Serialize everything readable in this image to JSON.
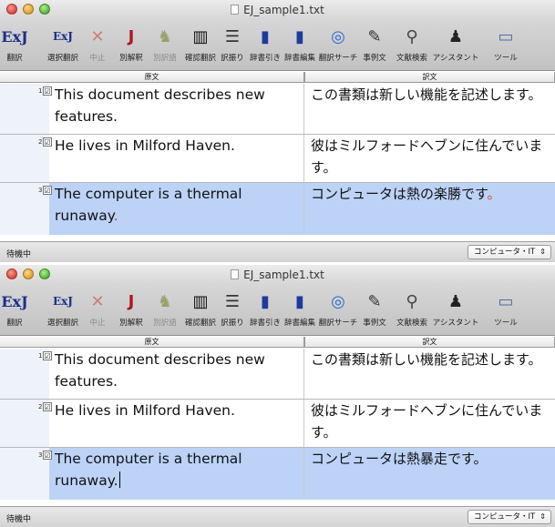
{
  "windows": [
    {
      "title": "EJ_sample1.txt",
      "toolbar": [
        {
          "label": "翻訳",
          "icon": "ExJ",
          "color": "#1a2f8a",
          "disabled": false
        },
        {
          "label": "選択翻訳",
          "icon": "ExJ",
          "color": "#1a2f8a",
          "disabled": false
        },
        {
          "label": "中止",
          "icon": "✕",
          "color": "#d23a2a",
          "disabled": true
        },
        {
          "label": "別解釈",
          "icon": "J",
          "color": "#b0171f",
          "disabled": false
        },
        {
          "label": "別訳語",
          "icon": "♞",
          "color": "#6e7d1a",
          "disabled": true
        },
        {
          "label": "確認翻訳",
          "icon": "▥",
          "color": "#111111",
          "disabled": false
        },
        {
          "label": "訳振り",
          "icon": "☰",
          "color": "#333333",
          "disabled": false
        },
        {
          "label": "辞書引き",
          "icon": "▮",
          "color": "#1d3b9e",
          "disabled": false
        },
        {
          "label": "辞書編集",
          "icon": "▮",
          "color": "#1d3b9e",
          "disabled": false
        },
        {
          "label": "翻訳サーチ",
          "icon": "◎",
          "color": "#2a6bd0",
          "disabled": false
        },
        {
          "label": "事例文",
          "icon": "✎",
          "color": "#333333",
          "disabled": false
        },
        {
          "label": "文献検索",
          "icon": "⚲",
          "color": "#444444",
          "disabled": false
        },
        {
          "label": "アシスタント",
          "icon": "♟",
          "color": "#222222",
          "disabled": false
        },
        {
          "label": "ツール",
          "icon": "▭",
          "color": "#4a6fa0",
          "disabled": false
        }
      ],
      "columns": {
        "source": "原文",
        "target": "訳文"
      },
      "rows": [
        {
          "num": "1",
          "checked": "☑",
          "source": "This document describes new features.",
          "target": "この書類は新しい機能を記述します。",
          "selected": false
        },
        {
          "num": "2",
          "checked": "☑",
          "source": "He lives in Milford Haven.",
          "target": "彼はミルフォードヘブンに住んでいます。",
          "selected": false
        },
        {
          "num": "3",
          "checked": "☑",
          "source_main": "The computer is a thermal runaway",
          "source_end": ".",
          "target_main": "コンピュータは熱の楽勝です",
          "target_end": "。",
          "selected": true
        }
      ],
      "status": "待機中",
      "field": "コンピュータ・IT",
      "field_arrow": "⇕"
    },
    {
      "title": "EJ_sample1.txt",
      "columns": {
        "source": "原文",
        "target": "訳文"
      },
      "rows": [
        {
          "num": "1",
          "checked": "☑",
          "source": "This document describes new features.",
          "target": "この書類は新しい機能を記述します。",
          "selected": false
        },
        {
          "num": "2",
          "checked": "☑",
          "source": "He lives in Milford Haven.",
          "target": "彼はミルフォードヘブンに住んでいます。",
          "selected": false
        },
        {
          "num": "3",
          "checked": "☑",
          "source_main": "The computer is a thermal runaway.",
          "target_main": "コンピュータは熱暴走です。",
          "selected": true
        }
      ],
      "status": "待機中",
      "field": "コンピュータ・IT",
      "field_arrow": "⇕"
    }
  ]
}
